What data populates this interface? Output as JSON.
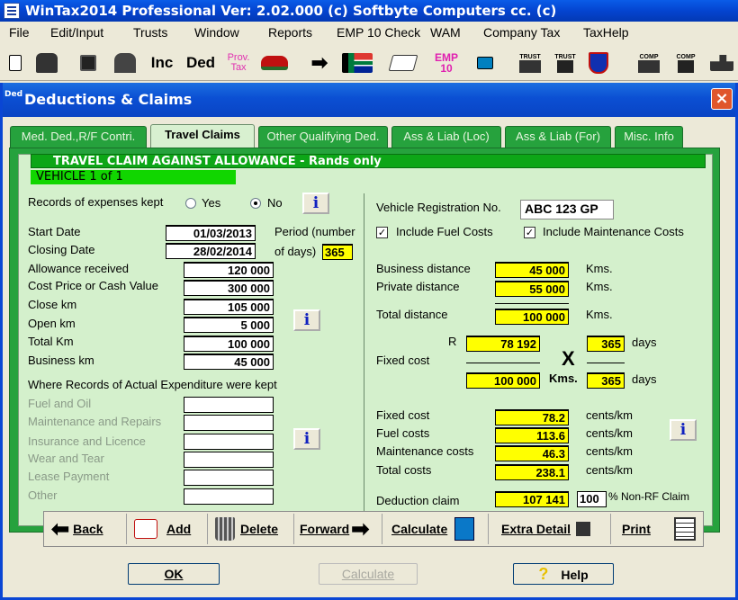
{
  "window": {
    "title": "WinTax2014 Professional Ver: 2.02.000  (c) Softbyte Computers cc.  (c)"
  },
  "menu": [
    "File",
    "Edit/Input",
    "Trusts",
    "Window",
    "Reports",
    "EMP 10 Check",
    "WAM",
    "Company Tax",
    "TaxHelp"
  ],
  "toolbar": {
    "inc": "Inc",
    "ded": "Ded",
    "prov1": "Prov.",
    "prov2": "Tax",
    "emp1": "EMP",
    "emp2": "10",
    "trust": "TRUST",
    "comp": "COMP"
  },
  "dialog": {
    "icon": "Ded",
    "title": "Deductions & Claims",
    "close": "×"
  },
  "tabs": [
    "Med. Ded.,R/F Contri.",
    "Travel Claims",
    "Other Qualifying Ded.",
    "Ass & Liab (Loc)",
    "Ass & Liab (For)",
    "Misc. Info"
  ],
  "banner": "TRAVEL CLAIM AGAINST ALLOWANCE - Rands only",
  "vehicle": "VEHICLE 1 of 1",
  "left": {
    "records_label": "Records of expenses kept",
    "yes": "Yes",
    "no": "No",
    "records_selected": "No",
    "start_date_label": "Start Date",
    "start_date": "01/03/2013",
    "closing_date_label": "Closing Date",
    "closing_date": "28/02/2014",
    "period_label1": "Period (number",
    "period_label2": "of days)",
    "period_days": "365",
    "allowance_label": "Allowance received",
    "allowance": "120 000",
    "cost_label": "Cost Price or Cash Value",
    "cost": "300 000",
    "close_km_label": "Close km",
    "close_km": "105 000",
    "open_km_label": "Open km",
    "open_km": "5 000",
    "total_km_label": "Total  Km",
    "total_km": "100 000",
    "business_km_label": "Business km",
    "business_km": "45 000",
    "records_where": "Where Records of Actual Expenditure were kept",
    "fuel": "Fuel and Oil",
    "maint": "Maintenance and Repairs",
    "insurance": "Insurance and Licence",
    "wear": "Wear and Tear",
    "lease": "Lease Payment",
    "other": "Other"
  },
  "right": {
    "reg_label": "Vehicle Registration No.",
    "reg": "ABC 123 GP",
    "fuel_chk": "Include Fuel Costs",
    "maint_chk": "Include Maintenance Costs",
    "bus_dist_label": "Business distance",
    "bus_dist": "45 000",
    "priv_dist_label": "Private distance",
    "priv_dist": "55 000",
    "total_dist_label": "Total distance",
    "total_dist": "100 000",
    "kms": "Kms.",
    "r": "R",
    "fixed_r": "78 192",
    "days1": "365",
    "days_label": "days",
    "fixed_label": "Fixed cost",
    "x": "X",
    "fixed_km": "100 000",
    "kms_bold": "Kms.",
    "days2": "365",
    "fixed_cost_label": "Fixed cost",
    "fixed_cost": "78.2",
    "fuel_cost_label": "Fuel costs",
    "fuel_cost": "113.6",
    "maint_cost_label": "Maintenance costs",
    "maint_cost": "46.3",
    "total_cost_label": "Total costs",
    "total_cost": "238.1",
    "cents": "cents/km",
    "deduction_label": "Deduction claim",
    "deduction": "107 141",
    "nonrf": "100",
    "nonrf_label": "% Non-RF Claim"
  },
  "nav": {
    "back": "Back",
    "add": "Add",
    "delete": "Delete",
    "forward": "Forward",
    "calculate": "Calculate",
    "extra": "Extra Detail",
    "print": "Print"
  },
  "bottom": {
    "ok": "OK",
    "calculate": "Calculate",
    "help": "Help"
  }
}
